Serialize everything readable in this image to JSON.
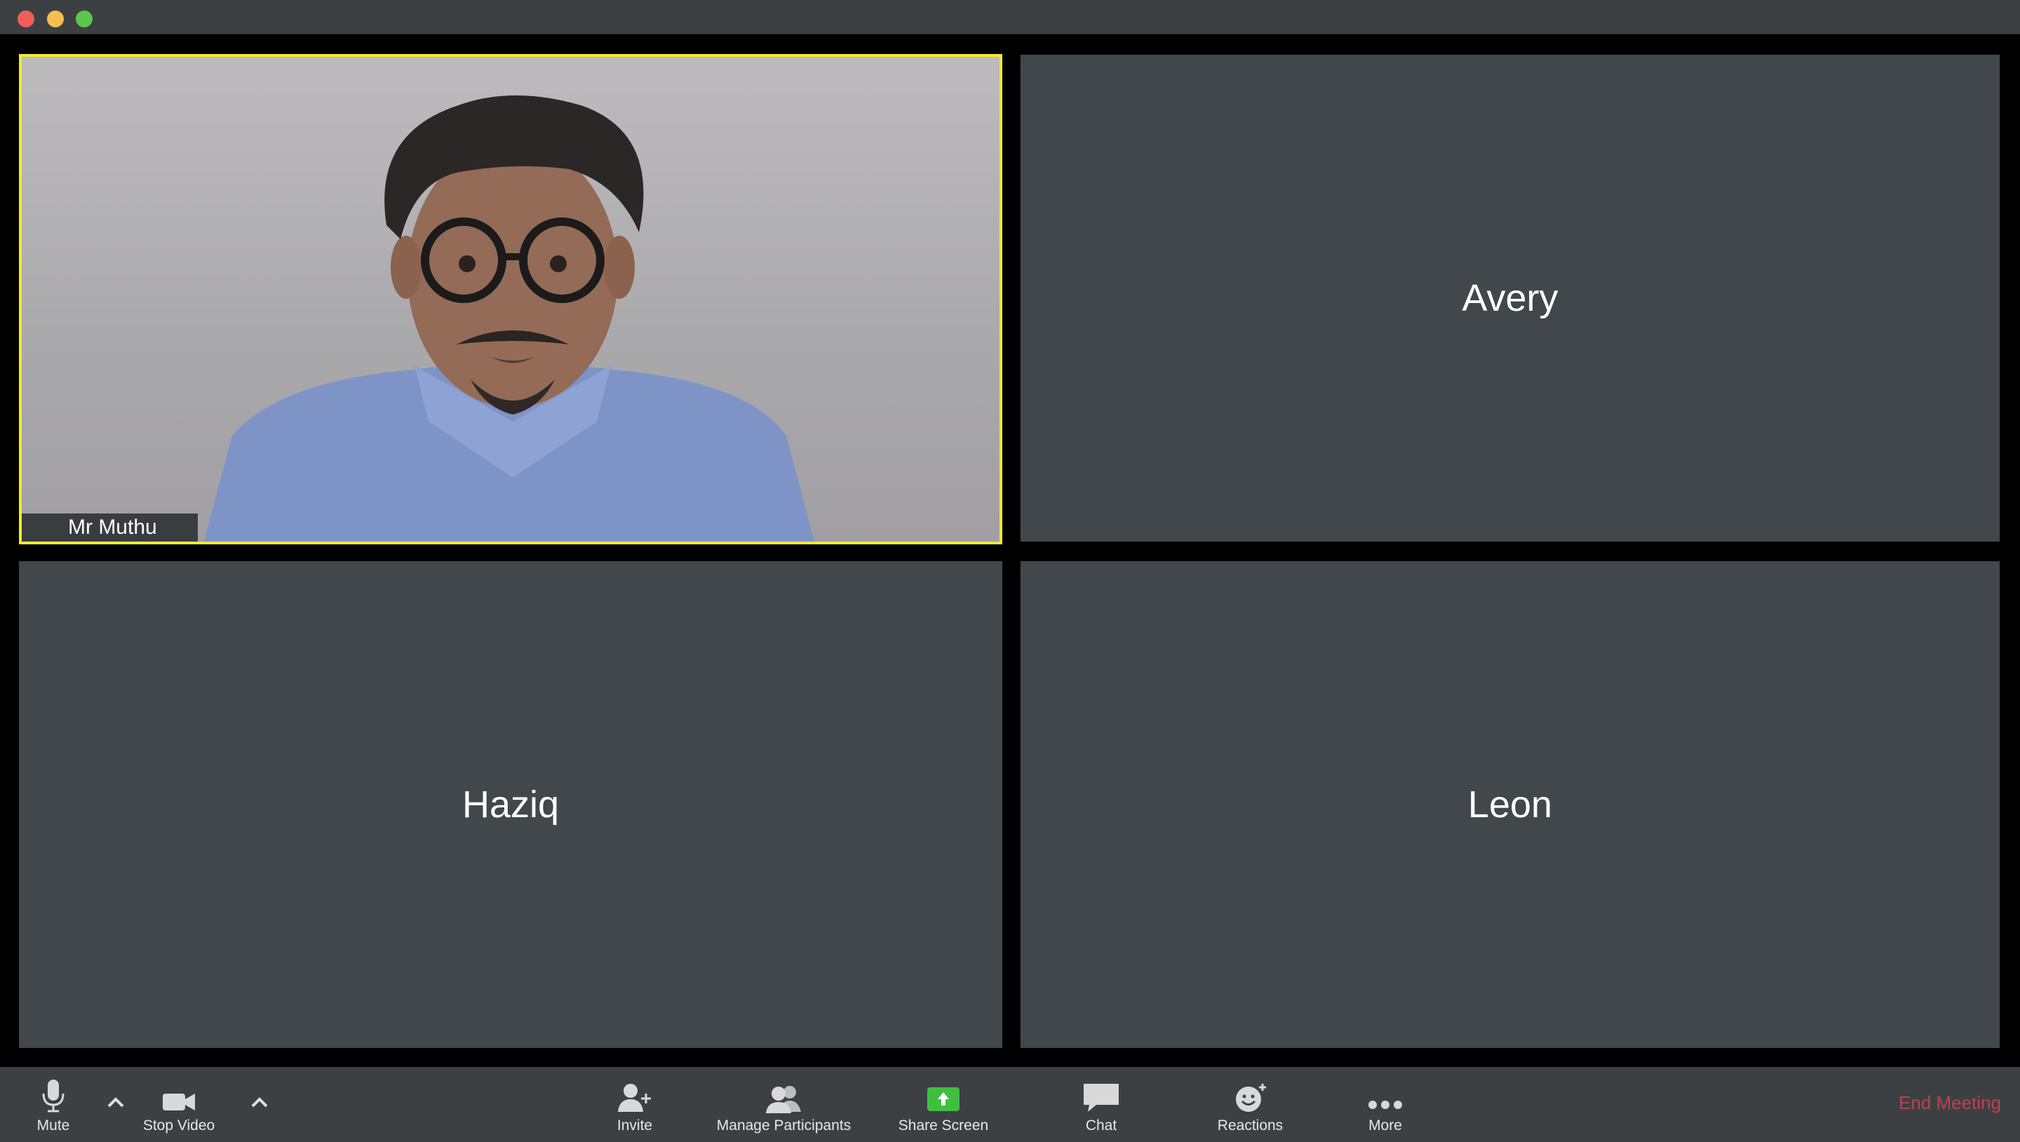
{
  "window": {
    "controls": [
      "close",
      "minimize",
      "maximize"
    ]
  },
  "tiles": [
    {
      "name": "Mr Muthu",
      "video": true,
      "active_speaker": true
    },
    {
      "name": "Avery",
      "video": false
    },
    {
      "name": "Haziq",
      "video": false
    },
    {
      "name": "Leon",
      "video": false
    }
  ],
  "toolbar": {
    "mute": "Mute",
    "stop_video": "Stop Video",
    "invite": "Invite",
    "manage_participants": "Manage Participants",
    "share_screen": "Share Screen",
    "chat": "Chat",
    "reactions": "Reactions",
    "more": "More",
    "end_meeting": "End Meeting"
  },
  "colors": {
    "active_speaker_border": "#f2e92f",
    "share_screen_green": "#3fbf3f",
    "end_meeting_red": "#c9444d",
    "tile_bg": "#42474c"
  }
}
